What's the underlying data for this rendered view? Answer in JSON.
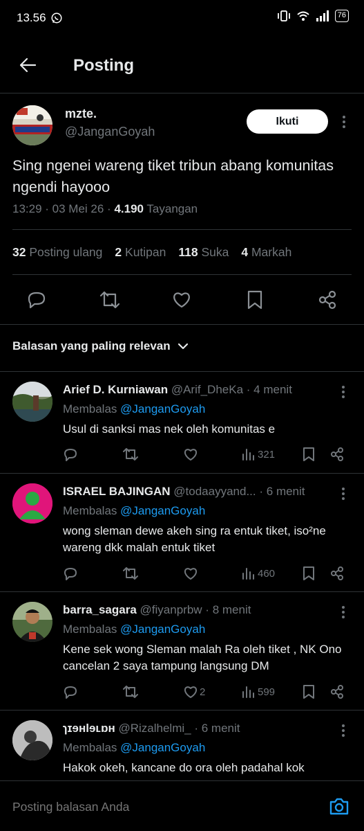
{
  "status": {
    "time": "13.56",
    "battery": "76"
  },
  "header": {
    "title": "Posting"
  },
  "post": {
    "name": "mzte.",
    "handle": "@JanganGoyah",
    "follow_label": "Ikuti",
    "text": "Sing ngenei wareng tiket tribun abang komunitas ngendi hayooo",
    "time": "13:29",
    "date": "03 Mei 26",
    "views": "4.190",
    "views_label": "Tayangan",
    "stats": [
      {
        "count": "32",
        "label": "Posting ulang"
      },
      {
        "count": "2",
        "label": "Kutipan"
      },
      {
        "count": "118",
        "label": "Suka"
      },
      {
        "count": "4",
        "label": "Markah"
      }
    ]
  },
  "replies_filter": {
    "label": "Balasan yang paling relevan"
  },
  "replies": [
    {
      "name": "Arief D. Kurniawan",
      "handle": "@Arif_DheKa",
      "time": "4 menit",
      "replying_prefix": "Membalas",
      "replying_to": "@JanganGoyah",
      "text": "Usul di sanksi mas nek oleh komunitas e",
      "likes": "",
      "views": "321"
    },
    {
      "name": "ISRAEL BAJINGAN",
      "handle": "@todaayyand...",
      "time": "6 menit",
      "replying_prefix": "Membalas",
      "replying_to": "@JanganGoyah",
      "text": "wong sleman dewe akeh sing ra entuk tiket, iso²ne wareng dkk malah entuk tiket",
      "likes": "",
      "views": "460"
    },
    {
      "name": "barra_sagara",
      "handle": "@fiyanprbw",
      "time": "8 menit",
      "replying_prefix": "Membalas",
      "replying_to": "@JanganGoyah",
      "text": "Kene sek wong Sleman malah Ra oleh tiket , NK Ono cancelan 2 saya tampung langsung DM",
      "likes": "2",
      "views": "599"
    },
    {
      "name": "ɿɪɘʜlɘʟɒʜ",
      "handle": "@Rizalhelmi_",
      "time": "6 menit",
      "replying_prefix": "Membalas",
      "replying_to": "@JanganGoyah",
      "text": "Hakok okeh, kancane do ora oleh padahal kok",
      "likes": "",
      "views": ""
    }
  ],
  "compose": {
    "placeholder": "Posting balasan Anda"
  },
  "colors": {
    "background": "#000000",
    "text": "#e7e9ea",
    "muted": "#71767b",
    "accent": "#1d9bf0",
    "divider": "#2f3336"
  },
  "icons": [
    "whatsapp-icon",
    "vibrate-icon",
    "wifi-icon",
    "signal-icon",
    "back-arrow-icon",
    "more-icon",
    "reply-icon",
    "repost-icon",
    "like-icon",
    "bookmark-icon",
    "share-icon",
    "views-icon",
    "chevron-down-icon",
    "camera-icon"
  ]
}
